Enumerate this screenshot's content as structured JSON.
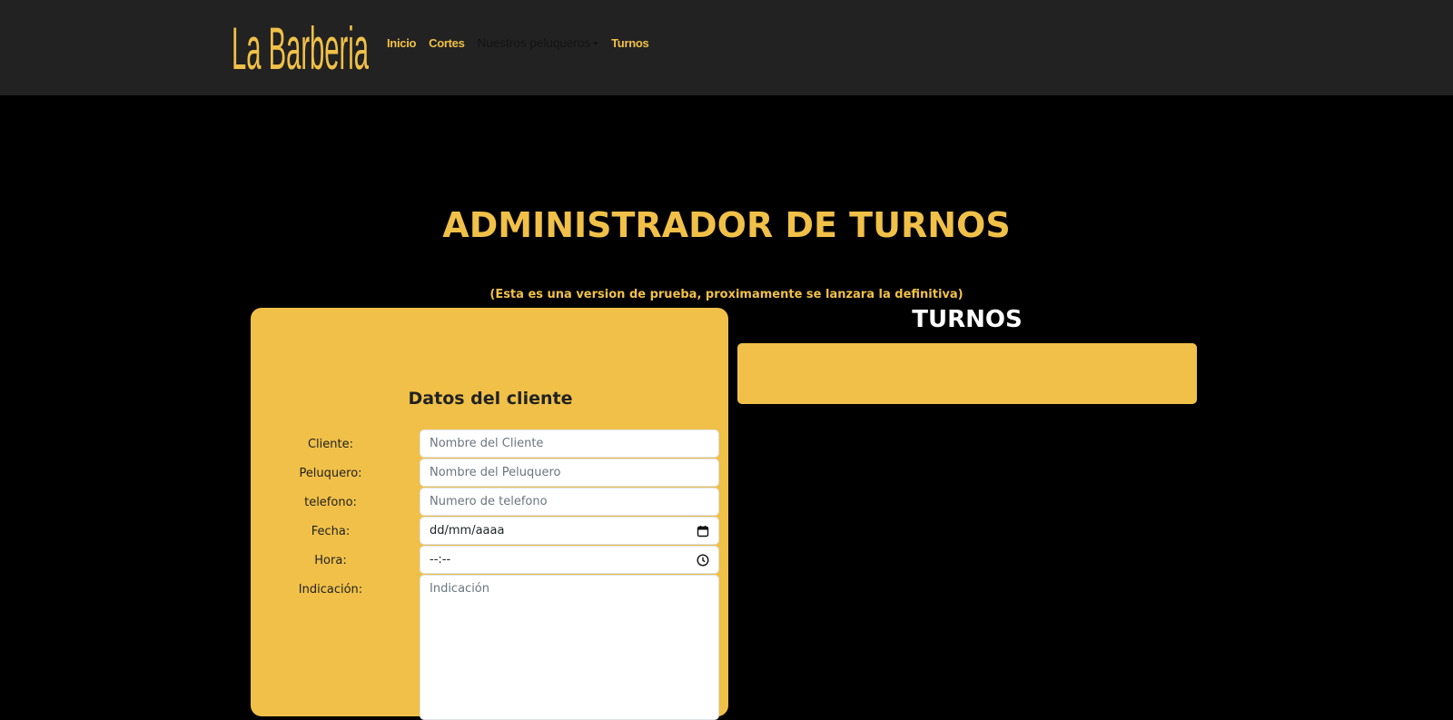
{
  "brand": {
    "name": "La Barberia"
  },
  "nav": {
    "inicio": "Inicio",
    "cortes": "Cortes",
    "peluqueros": "Nuestros peluqueros",
    "turnos": "Turnos"
  },
  "page": {
    "title": "ADMINISTRADOR DE TURNOS",
    "subtitle": "(Esta es una version de prueba, proximamente se lanzara la definitiva)"
  },
  "form": {
    "heading": "Datos del cliente",
    "cliente_label": "Cliente:",
    "cliente_placeholder": "Nombre del Cliente",
    "peluquero_label": "Peluquero:",
    "peluquero_placeholder": "Nombre del Peluquero",
    "telefono_label": "telefono:",
    "telefono_placeholder": "Numero de telefono",
    "fecha_label": "Fecha:",
    "fecha_value": "dd/mm/aaaa",
    "hora_label": "Hora:",
    "hora_value": "--:--",
    "indicacion_label": "Indicación:",
    "indicacion_placeholder": "Indicación"
  },
  "turnos": {
    "title": "TURNOS"
  },
  "colors": {
    "accent": "#f0c048",
    "navbar": "#222222",
    "background": "#000000"
  },
  "icons": {
    "calendar": "calendar-icon",
    "clock": "clock-icon"
  }
}
